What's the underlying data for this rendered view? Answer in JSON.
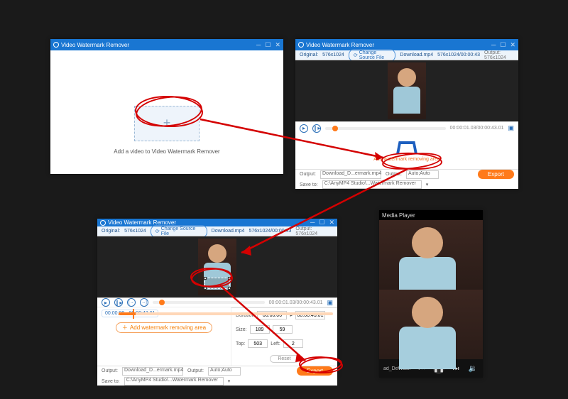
{
  "app_title": "Video Watermark Remover",
  "win1": {
    "dropzone_plus": "+",
    "hint": "Add a video to Video Watermark Remover"
  },
  "subbar": {
    "original_label": "Original:",
    "original_value": "576x1024",
    "change_source": "Change Source File",
    "filename": "Download.mp4",
    "dimensions_duration": "576x1024/00:00:43",
    "output_label": "Output:",
    "output_value": "576x1024"
  },
  "playback": {
    "time_display": "00:00:01.03/00:00:43.01"
  },
  "win2": {
    "add_area": "Add watermark removing area"
  },
  "win3": {
    "range_chip": "00:00:00 - 00:00:43.01",
    "duration_label": "Duration",
    "duration_start": "00:00:00",
    "duration_end": "00:00:43.01",
    "size_label": "Size:",
    "size_w": "189",
    "size_h": "59",
    "top_label": "Top:",
    "top_v": "503",
    "left_label": "Left:",
    "left_v": "2",
    "add_area": "Add watermark removing area",
    "reset": "Reset"
  },
  "footer": {
    "output_lbl": "Output:",
    "output_file": "Download_D...ermark.mp4",
    "outfmt_lbl": "Output:",
    "outfmt_val": "Auto;Auto",
    "save_lbl": "Save to:",
    "save_path": "C:\\AnyMP4 Studio\\...Watermark Remover",
    "export": "Export"
  },
  "media_player": {
    "title": "Media Player",
    "filename": "ad_DeWate..."
  }
}
